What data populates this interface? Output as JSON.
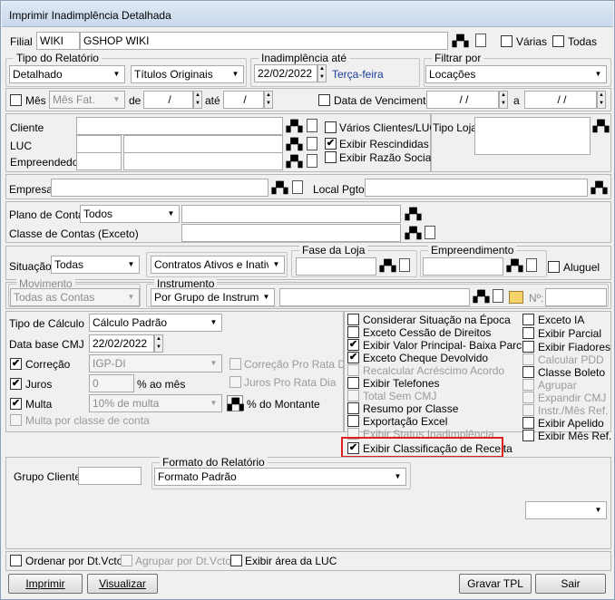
{
  "window": {
    "title": "Imprimir Inadimplência Detalhada"
  },
  "filial": {
    "label": "Filial",
    "code": "WIKI",
    "name": "GSHOP WIKI",
    "varias": "Várias",
    "todas": "Todas"
  },
  "tipo_relatorio": {
    "label": "Tipo do Relatório",
    "value1": "Detalhado",
    "value2": "Títulos Originais"
  },
  "inadimplencia": {
    "label": "Inadimplência até",
    "date": "22/02/2022",
    "weekday": "Terça-feira"
  },
  "filtrar": {
    "label": "Filtrar por",
    "value": "Locações"
  },
  "mes": {
    "label": "Mês",
    "value": "Mês Fat.",
    "de": "de",
    "de_val": "/",
    "ate": "até",
    "ate_val": "/",
    "venc_label": "Data de Vencimento",
    "venc_from": "/  /",
    "a": "a",
    "venc_to": "/  /"
  },
  "cliente": {
    "cliente": "Cliente",
    "luc": "LUC",
    "empreendedor": "Empreendedor",
    "varios": "Vários Clientes/LUC",
    "rescindidas": "Exibir Rescindidas",
    "razao": "Exibir Razão Social",
    "tipo_loja": "Tipo Loja"
  },
  "empresa": {
    "label": "Empresa",
    "local": "Local Pgto"
  },
  "contas": {
    "plano": "Plano de Contas",
    "plano_val": "Todos",
    "classe": "Classe de Contas (Exceto)"
  },
  "situacao": {
    "label": "Situação",
    "value": "Todas",
    "contratos": "Contratos Ativos e Inativo",
    "fase": "Fase da Loja",
    "empreendimento": "Empreendimento",
    "aluguel": "Aluguel"
  },
  "movimento": {
    "label": "Movimento",
    "value": "Todas as Contas",
    "instrumento": "Instrumento",
    "instr_val": "Por Grupo de Instrumento",
    "no": "Nº:"
  },
  "calculo": {
    "tipo": "Tipo de Cálculo",
    "tipo_val": "Cálculo Padrão",
    "base": "Data base CMJ",
    "base_val": "22/02/2022",
    "correcao": "Correção",
    "correcao_val": "IGP-DI",
    "correcao_pro": "Correção Pro Rata Dia",
    "juros": "Juros",
    "juros_val": "0",
    "ao_mes": "% ao mês",
    "juros_pro": "Juros Pro Rata Dia",
    "multa": "Multa",
    "multa_val": "10% de multa",
    "montante": "% do Montante",
    "multa_classe": "Multa por classe de conta"
  },
  "options_left": [
    "Considerar Situação na Época",
    "Exceto Cessão de Direitos",
    "Exibir Valor Principal- Baixa Parcial",
    "Exceto Cheque Devolvido",
    "Recalcular Acréscimo Acordo",
    "Exibir Telefones",
    "Total Sem CMJ",
    "Resumo por Classe",
    "Exportação Excel",
    "Exibir Status Inadimplência",
    "Exibir Classificação de Receita"
  ],
  "options_right": [
    "Exceto IA",
    "Exibir Parcial",
    "Exibir Fiadores",
    "Calcular PDD",
    "Classe Boleto",
    "Agrupar",
    "Expandir CMJ",
    "Instr./Mês Ref.",
    "Exibir Apelido",
    "Exibir Mês Ref."
  ],
  "grupo": {
    "label": "Grupo Cliente",
    "formato": "Formato do Relatório",
    "formato_val": "Formato Padrão"
  },
  "bottom": {
    "ordenar": "Ordenar por Dt.Vcto",
    "agrupar": "Agrupar por Dt.Vcto",
    "area": "Exibir área da LUC"
  },
  "buttons": {
    "imprimir": "Imprimir",
    "visualizar": "Visualizar",
    "gravar": "Gravar TPL",
    "sair": "Sair"
  },
  "check": "✔",
  "arrow": "▼",
  "bin": "▞▚"
}
